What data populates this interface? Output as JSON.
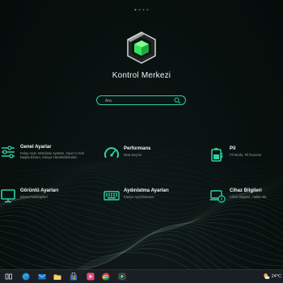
{
  "app": {
    "title": "Kontrol Merkezi",
    "page_indicator_count": 4,
    "accent_color": "#2fd1a5",
    "logo_color": "#36e35a"
  },
  "search": {
    "placeholder": "Ara",
    "icon": "search-icon"
  },
  "tiles": [
    {
      "name": "Genel Ayarlar",
      "desc": "Kolay Ayar, Windows Ayarları, Oyun’u Hızlı Başlat Ekranı, Klavye Hareketlerinden",
      "icon": "settings-sliders-icon"
    },
    {
      "name": "Performans",
      "desc": "Mod Seçimi",
      "icon": "speedometer-icon"
    },
    {
      "name": "Pil",
      "desc": "Pil Modu, Pil Durumu",
      "icon": "battery-icon"
    },
    {
      "name": "Görüntü Ayarları",
      "desc": "Ekran Fotokopileri",
      "icon": "monitor-icon"
    },
    {
      "name": "Aydınlatma Ayarları",
      "desc": "Klavye Aydınlatması",
      "icon": "keyboard-icon"
    },
    {
      "name": "Cihaz Bilgileri",
      "desc": "Cihaz Bilgileri, Hakkında",
      "icon": "device-info-icon"
    }
  ],
  "taskbar": {
    "apps": [
      "task-view-icon",
      "edge-icon",
      "mail-icon",
      "file-explorer-icon",
      "store-icon",
      "media-player-icon",
      "chrome-icon",
      "control-center-app-icon"
    ],
    "weather_temp": "24°C",
    "weather_icon": "sun-cloud-icon"
  }
}
